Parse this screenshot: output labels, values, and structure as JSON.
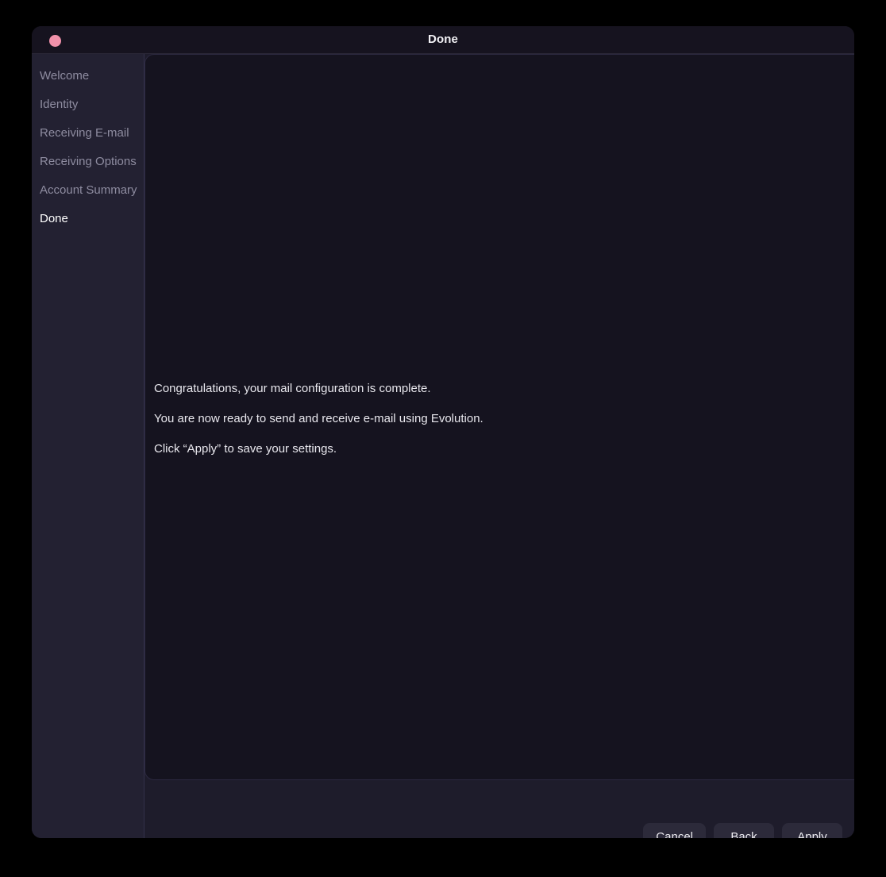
{
  "window": {
    "title": "Done",
    "close_dot_color": "#f191aa",
    "background": "#1e1c2b"
  },
  "sidebar": {
    "items": [
      {
        "label": "Welcome",
        "active": false
      },
      {
        "label": "Identity",
        "active": false
      },
      {
        "label": "Receiving E-mail",
        "active": false
      },
      {
        "label": "Receiving Options",
        "active": false
      },
      {
        "label": "Account Summary",
        "active": false
      },
      {
        "label": "Done",
        "active": true
      }
    ]
  },
  "page": {
    "lines": [
      "Congratulations, your mail configuration is complete.",
      "You are now ready to send and receive e-mail using Evolution.",
      "Click “Apply” to save your settings."
    ]
  },
  "actions": {
    "cancel_label": "Cancel",
    "back_label": "Back",
    "apply_label": "Apply"
  }
}
